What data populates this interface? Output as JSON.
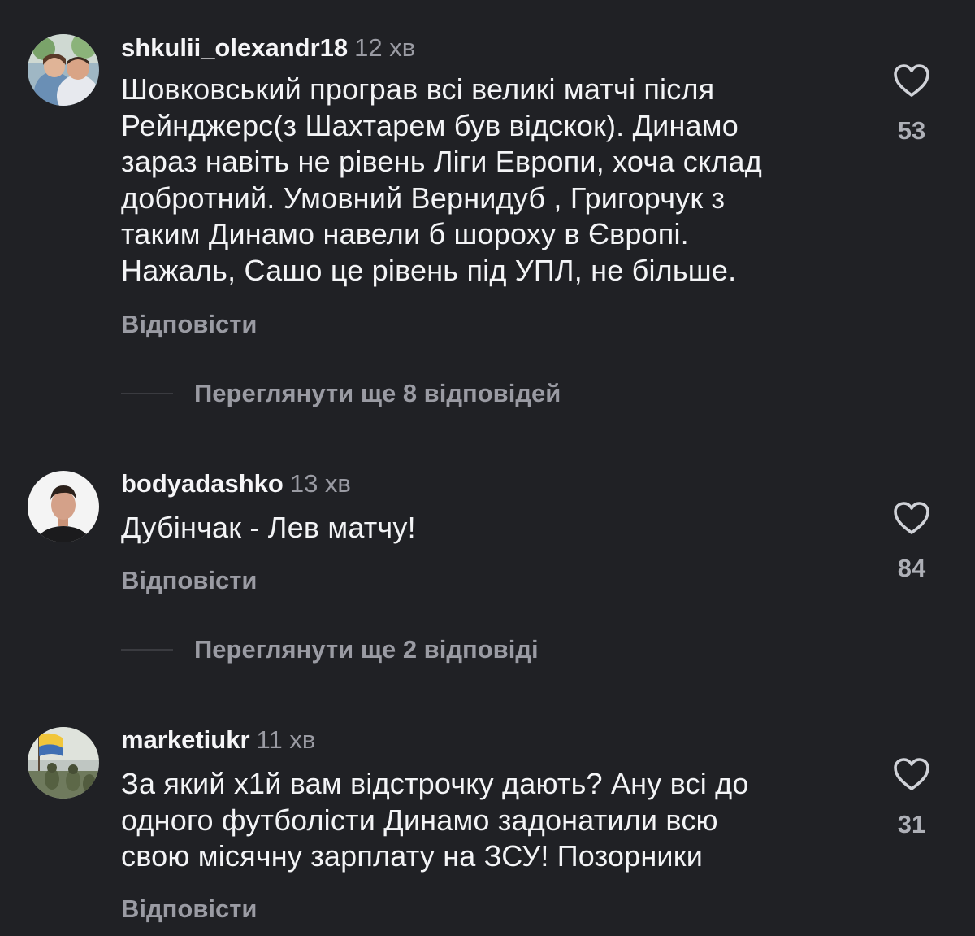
{
  "comments": [
    {
      "username": "shkulii_olexandr18",
      "time": "12 хв",
      "text_lines": [
        "Шовковський програв всі великі матчі після",
        "Рейнджерс(з Шахтарем був відскок). Динамо",
        "зараз навіть не рівень Ліги Европи, хоча склад",
        "добротний. Умовний Вернидуб , Григорчук з",
        "таким Динамо навели б шороху в Європі.",
        "Нажаль, Сашо це рівень під УПЛ, не більше."
      ],
      "reply_label": "Відповісти",
      "likes": "53",
      "view_replies": "Переглянути ще 8 відповідей",
      "avatar_icon": "profile-photo-couple"
    },
    {
      "username": "bodyadashko",
      "time": "13 хв",
      "text_lines": [
        "Дубінчак - Лев матчу!"
      ],
      "reply_label": "Відповісти",
      "likes": "84",
      "view_replies": "Переглянути ще 2 відповіді",
      "avatar_icon": "profile-photo-man"
    },
    {
      "username": "marketiukr",
      "time": "11 хв",
      "text_lines": [
        "За який х1й вам відстрочку дають? Ану всі до",
        "одного футболісти Динамо задонатили всю",
        "свою місячну зарплату на ЗСУ! Позорники"
      ],
      "reply_label": "Відповісти",
      "likes": "31",
      "avatar_icon": "profile-photo-soldiers-flag"
    }
  ],
  "colors": {
    "background": "#202125",
    "primary_text": "#f3f4f6",
    "secondary_text": "#9a9ba3",
    "like_count": "#aeb0b7"
  },
  "icons": {
    "like": "heart-outline-icon"
  }
}
